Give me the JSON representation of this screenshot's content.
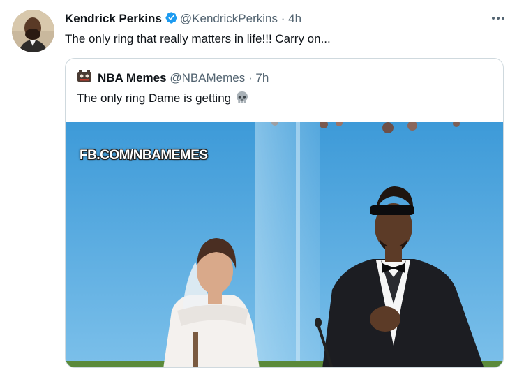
{
  "tweet": {
    "author_name": "Kendrick Perkins",
    "handle": "@KendrickPerkins",
    "separator": "·",
    "time": "4h",
    "text": "The only ring that really matters in life!!! Carry on...",
    "more_icon": "more-horizontal-icon",
    "verified_icon": "verified-badge-icon",
    "colors": {
      "verified": "#1d9bf0",
      "secondary_text": "#536471",
      "border": "#cfd9de"
    }
  },
  "quoted": {
    "author_name": "NBA Memes",
    "handle": "@NBAMemes",
    "separator": "·",
    "time": "7h",
    "text": "The only ring Dame is getting",
    "emoji_icon": "skull-icon",
    "media": {
      "watermark": "FB.COM/NBAMEMES"
    }
  }
}
